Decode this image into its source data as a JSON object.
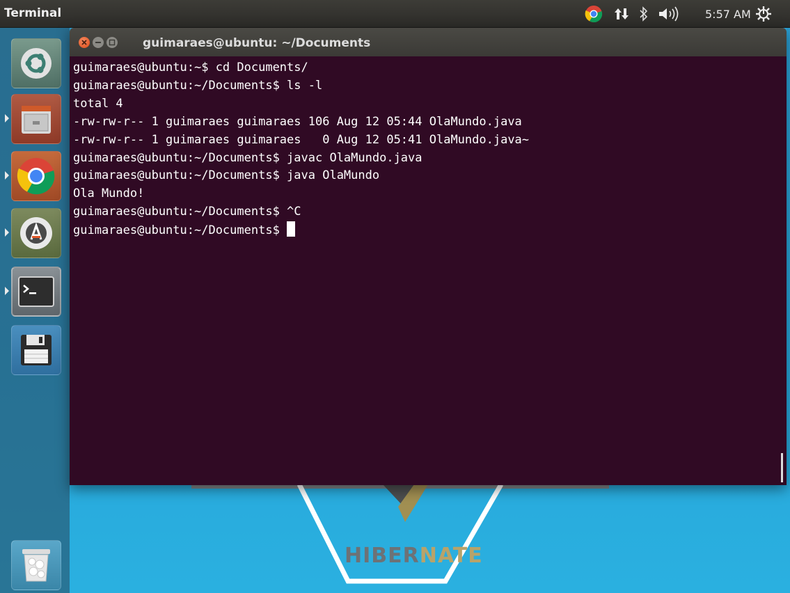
{
  "top_panel": {
    "app_title": "Terminal",
    "clock": "5:57 AM",
    "icons": [
      "chrome-icon",
      "network-icon",
      "bluetooth-icon",
      "volume-icon",
      "settings-icon"
    ]
  },
  "launcher": {
    "items": [
      "ubuntu-dash",
      "files",
      "chromium",
      "software-updater",
      "terminal",
      "save",
      "trash"
    ]
  },
  "terminal": {
    "window_title": "guimaraes@ubuntu: ~/Documents",
    "background_color": "#300a24",
    "lines": [
      "guimaraes@ubuntu:~$ cd Documents/",
      "guimaraes@ubuntu:~/Documents$ ls -l",
      "total 4",
      "-rw-rw-r-- 1 guimaraes guimaraes 106 Aug 12 05:44 OlaMundo.java",
      "-rw-rw-r-- 1 guimaraes guimaraes   0 Aug 12 05:41 OlaMundo.java~",
      "guimaraes@ubuntu:~/Documents$ javac OlaMundo.java",
      "guimaraes@ubuntu:~/Documents$ java OlaMundo",
      "Ola Mundo!",
      "guimaraes@ubuntu:~/Documents$ ^C"
    ],
    "prompt": "guimaraes@ubuntu:~/Documents$ "
  },
  "wallpaper": {
    "text_part1": "HIBER",
    "text_part2": "NATE"
  }
}
